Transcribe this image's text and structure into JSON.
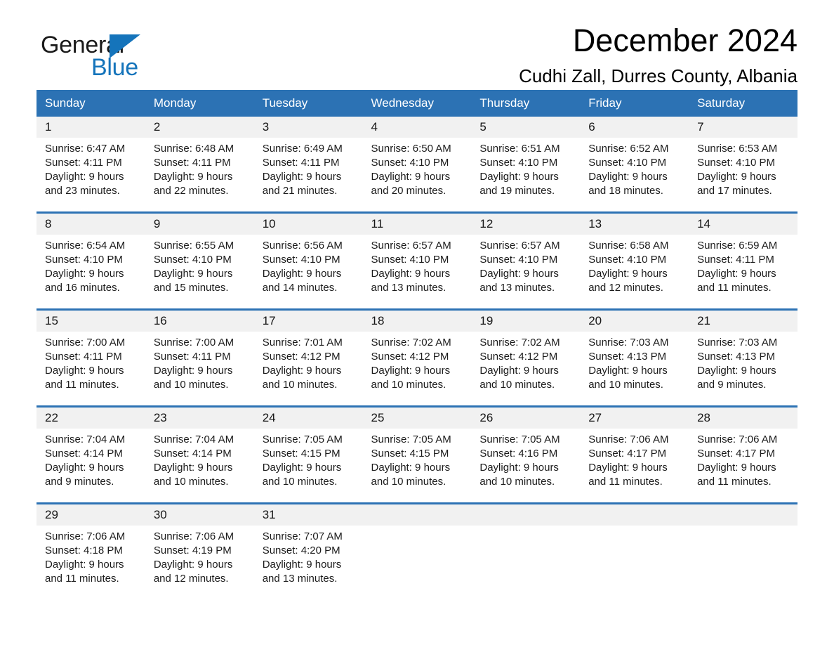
{
  "brand": {
    "word_one": "General",
    "word_two": "Blue",
    "triangle_color": "#1574bb"
  },
  "header": {
    "title": "December 2024",
    "subtitle": "Cudhi Zall, Durres County, Albania"
  },
  "theme": {
    "header_blue": "#2c72b4",
    "row_divider_blue": "#2c72b4",
    "daynum_band": "#f1f1f1",
    "page_background": "#ffffff"
  },
  "calendar": {
    "weekday_headers": [
      "Sunday",
      "Monday",
      "Tuesday",
      "Wednesday",
      "Thursday",
      "Friday",
      "Saturday"
    ],
    "weeks": [
      [
        {
          "day": "1",
          "sunrise": "Sunrise: 6:47 AM",
          "sunset": "Sunset: 4:11 PM",
          "daylight_1": "Daylight: 9 hours",
          "daylight_2": "and 23 minutes."
        },
        {
          "day": "2",
          "sunrise": "Sunrise: 6:48 AM",
          "sunset": "Sunset: 4:11 PM",
          "daylight_1": "Daylight: 9 hours",
          "daylight_2": "and 22 minutes."
        },
        {
          "day": "3",
          "sunrise": "Sunrise: 6:49 AM",
          "sunset": "Sunset: 4:11 PM",
          "daylight_1": "Daylight: 9 hours",
          "daylight_2": "and 21 minutes."
        },
        {
          "day": "4",
          "sunrise": "Sunrise: 6:50 AM",
          "sunset": "Sunset: 4:10 PM",
          "daylight_1": "Daylight: 9 hours",
          "daylight_2": "and 20 minutes."
        },
        {
          "day": "5",
          "sunrise": "Sunrise: 6:51 AM",
          "sunset": "Sunset: 4:10 PM",
          "daylight_1": "Daylight: 9 hours",
          "daylight_2": "and 19 minutes."
        },
        {
          "day": "6",
          "sunrise": "Sunrise: 6:52 AM",
          "sunset": "Sunset: 4:10 PM",
          "daylight_1": "Daylight: 9 hours",
          "daylight_2": "and 18 minutes."
        },
        {
          "day": "7",
          "sunrise": "Sunrise: 6:53 AM",
          "sunset": "Sunset: 4:10 PM",
          "daylight_1": "Daylight: 9 hours",
          "daylight_2": "and 17 minutes."
        }
      ],
      [
        {
          "day": "8",
          "sunrise": "Sunrise: 6:54 AM",
          "sunset": "Sunset: 4:10 PM",
          "daylight_1": "Daylight: 9 hours",
          "daylight_2": "and 16 minutes."
        },
        {
          "day": "9",
          "sunrise": "Sunrise: 6:55 AM",
          "sunset": "Sunset: 4:10 PM",
          "daylight_1": "Daylight: 9 hours",
          "daylight_2": "and 15 minutes."
        },
        {
          "day": "10",
          "sunrise": "Sunrise: 6:56 AM",
          "sunset": "Sunset: 4:10 PM",
          "daylight_1": "Daylight: 9 hours",
          "daylight_2": "and 14 minutes."
        },
        {
          "day": "11",
          "sunrise": "Sunrise: 6:57 AM",
          "sunset": "Sunset: 4:10 PM",
          "daylight_1": "Daylight: 9 hours",
          "daylight_2": "and 13 minutes."
        },
        {
          "day": "12",
          "sunrise": "Sunrise: 6:57 AM",
          "sunset": "Sunset: 4:10 PM",
          "daylight_1": "Daylight: 9 hours",
          "daylight_2": "and 13 minutes."
        },
        {
          "day": "13",
          "sunrise": "Sunrise: 6:58 AM",
          "sunset": "Sunset: 4:10 PM",
          "daylight_1": "Daylight: 9 hours",
          "daylight_2": "and 12 minutes."
        },
        {
          "day": "14",
          "sunrise": "Sunrise: 6:59 AM",
          "sunset": "Sunset: 4:11 PM",
          "daylight_1": "Daylight: 9 hours",
          "daylight_2": "and 11 minutes."
        }
      ],
      [
        {
          "day": "15",
          "sunrise": "Sunrise: 7:00 AM",
          "sunset": "Sunset: 4:11 PM",
          "daylight_1": "Daylight: 9 hours",
          "daylight_2": "and 11 minutes."
        },
        {
          "day": "16",
          "sunrise": "Sunrise: 7:00 AM",
          "sunset": "Sunset: 4:11 PM",
          "daylight_1": "Daylight: 9 hours",
          "daylight_2": "and 10 minutes."
        },
        {
          "day": "17",
          "sunrise": "Sunrise: 7:01 AM",
          "sunset": "Sunset: 4:12 PM",
          "daylight_1": "Daylight: 9 hours",
          "daylight_2": "and 10 minutes."
        },
        {
          "day": "18",
          "sunrise": "Sunrise: 7:02 AM",
          "sunset": "Sunset: 4:12 PM",
          "daylight_1": "Daylight: 9 hours",
          "daylight_2": "and 10 minutes."
        },
        {
          "day": "19",
          "sunrise": "Sunrise: 7:02 AM",
          "sunset": "Sunset: 4:12 PM",
          "daylight_1": "Daylight: 9 hours",
          "daylight_2": "and 10 minutes."
        },
        {
          "day": "20",
          "sunrise": "Sunrise: 7:03 AM",
          "sunset": "Sunset: 4:13 PM",
          "daylight_1": "Daylight: 9 hours",
          "daylight_2": "and 10 minutes."
        },
        {
          "day": "21",
          "sunrise": "Sunrise: 7:03 AM",
          "sunset": "Sunset: 4:13 PM",
          "daylight_1": "Daylight: 9 hours",
          "daylight_2": "and 9 minutes."
        }
      ],
      [
        {
          "day": "22",
          "sunrise": "Sunrise: 7:04 AM",
          "sunset": "Sunset: 4:14 PM",
          "daylight_1": "Daylight: 9 hours",
          "daylight_2": "and 9 minutes."
        },
        {
          "day": "23",
          "sunrise": "Sunrise: 7:04 AM",
          "sunset": "Sunset: 4:14 PM",
          "daylight_1": "Daylight: 9 hours",
          "daylight_2": "and 10 minutes."
        },
        {
          "day": "24",
          "sunrise": "Sunrise: 7:05 AM",
          "sunset": "Sunset: 4:15 PM",
          "daylight_1": "Daylight: 9 hours",
          "daylight_2": "and 10 minutes."
        },
        {
          "day": "25",
          "sunrise": "Sunrise: 7:05 AM",
          "sunset": "Sunset: 4:15 PM",
          "daylight_1": "Daylight: 9 hours",
          "daylight_2": "and 10 minutes."
        },
        {
          "day": "26",
          "sunrise": "Sunrise: 7:05 AM",
          "sunset": "Sunset: 4:16 PM",
          "daylight_1": "Daylight: 9 hours",
          "daylight_2": "and 10 minutes."
        },
        {
          "day": "27",
          "sunrise": "Sunrise: 7:06 AM",
          "sunset": "Sunset: 4:17 PM",
          "daylight_1": "Daylight: 9 hours",
          "daylight_2": "and 11 minutes."
        },
        {
          "day": "28",
          "sunrise": "Sunrise: 7:06 AM",
          "sunset": "Sunset: 4:17 PM",
          "daylight_1": "Daylight: 9 hours",
          "daylight_2": "and 11 minutes."
        }
      ],
      [
        {
          "day": "29",
          "sunrise": "Sunrise: 7:06 AM",
          "sunset": "Sunset: 4:18 PM",
          "daylight_1": "Daylight: 9 hours",
          "daylight_2": "and 11 minutes."
        },
        {
          "day": "30",
          "sunrise": "Sunrise: 7:06 AM",
          "sunset": "Sunset: 4:19 PM",
          "daylight_1": "Daylight: 9 hours",
          "daylight_2": "and 12 minutes."
        },
        {
          "day": "31",
          "sunrise": "Sunrise: 7:07 AM",
          "sunset": "Sunset: 4:20 PM",
          "daylight_1": "Daylight: 9 hours",
          "daylight_2": "and 13 minutes."
        },
        {
          "day": "",
          "sunrise": "",
          "sunset": "",
          "daylight_1": "",
          "daylight_2": ""
        },
        {
          "day": "",
          "sunrise": "",
          "sunset": "",
          "daylight_1": "",
          "daylight_2": ""
        },
        {
          "day": "",
          "sunrise": "",
          "sunset": "",
          "daylight_1": "",
          "daylight_2": ""
        },
        {
          "day": "",
          "sunrise": "",
          "sunset": "",
          "daylight_1": "",
          "daylight_2": ""
        }
      ]
    ]
  }
}
